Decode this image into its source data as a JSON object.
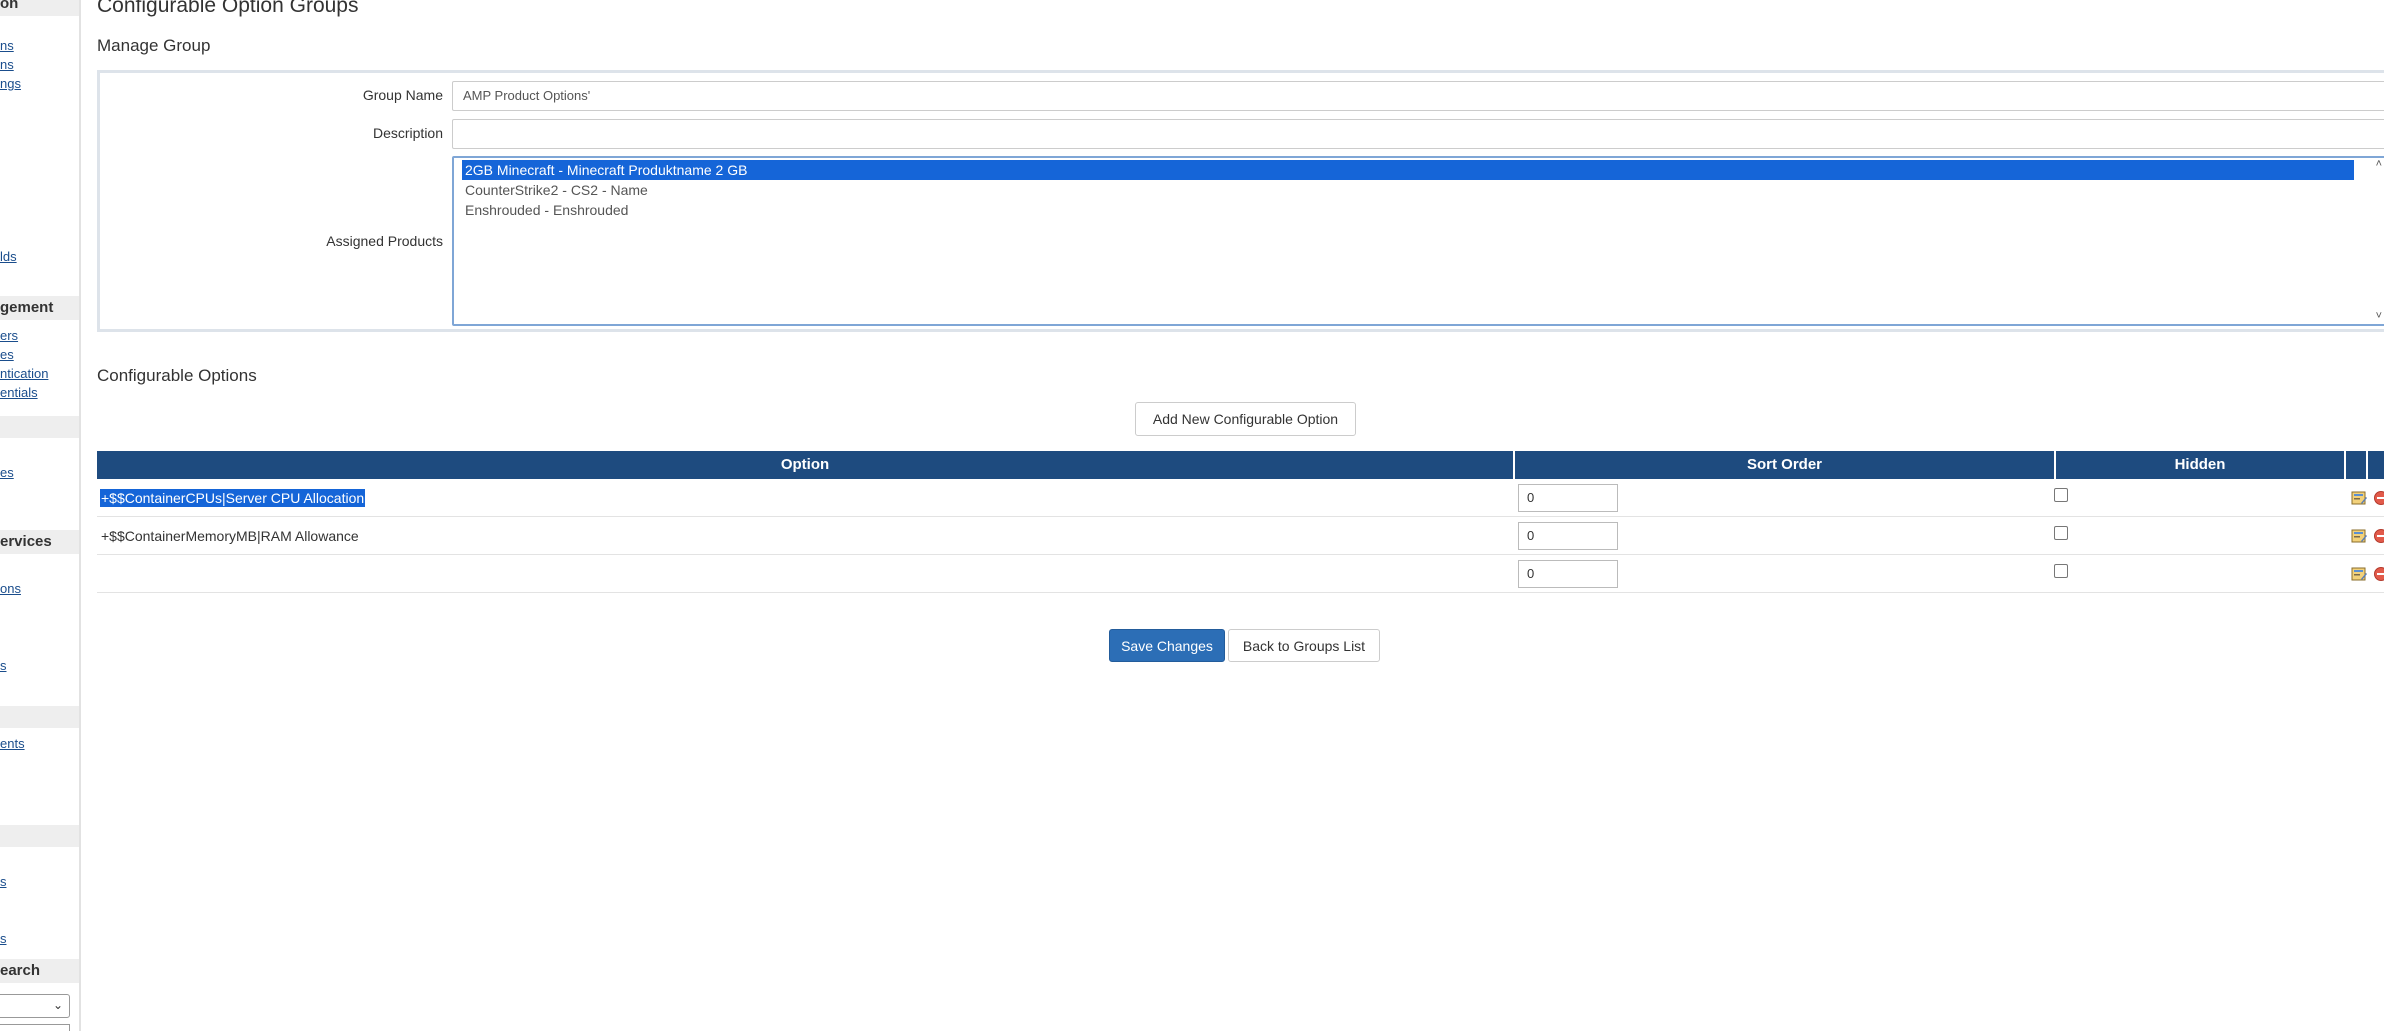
{
  "sidebar": {
    "links": [
      "on",
      "ns",
      "ns",
      "ngs",
      "lds",
      "ers",
      "es",
      "ntication",
      "entials",
      "es",
      "",
      "ons",
      "s",
      "ents",
      "s",
      "s"
    ],
    "headings": [
      "on",
      "gement",
      "ervices",
      "earch"
    ]
  },
  "page": {
    "title": "Configurable Option Groups",
    "manage_group_title": "Manage Group",
    "configurable_options_title": "Configurable Options"
  },
  "form": {
    "group_name_label": "Group Name",
    "group_name_value": "AMP Product Options'",
    "description_label": "Description",
    "description_value": "",
    "assigned_products_label": "Assigned Products",
    "assigned_products": [
      "2GB Minecraft - Minecraft Produktname 2 GB",
      "CounterStrike2 - CS2 - Name",
      "Enshrouded - Enshrouded"
    ],
    "selected_product_index": 0
  },
  "buttons": {
    "add_option": "Add New Configurable Option",
    "save": "Save Changes",
    "back": "Back to Groups List"
  },
  "table": {
    "headers": [
      "Option",
      "Sort Order",
      "Hidden"
    ],
    "rows": [
      {
        "option": "+$$ContainerCPUs|Server CPU Allocation",
        "sort_order": "0",
        "hidden": false,
        "highlighted": true
      },
      {
        "option": "+$$ContainerMemoryMB|RAM Allowance",
        "sort_order": "0",
        "hidden": false,
        "highlighted": false
      },
      {
        "option": "",
        "sort_order": "0",
        "hidden": false,
        "highlighted": false
      }
    ]
  },
  "colors": {
    "table_header": "#1e4b7f",
    "primary_button": "#2c6eb6",
    "selection": "#1565d8"
  }
}
